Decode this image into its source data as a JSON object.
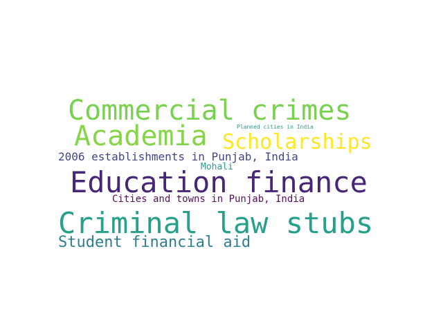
{
  "word_cloud": {
    "words": [
      {
        "text": "Commercial crimes",
        "color": "#7ad151"
      },
      {
        "text": "Academia",
        "color": "#86d549"
      },
      {
        "text": "Scholarships",
        "color": "#fde725"
      },
      {
        "text": "Planned cities in India",
        "color": "#2a9a8a"
      },
      {
        "text": "2006 establishments in Punjab, India",
        "color": "#414487"
      },
      {
        "text": "Mohali",
        "color": "#2a9d8f"
      },
      {
        "text": "Education finance",
        "color": "#482677"
      },
      {
        "text": "Cities and towns in Punjab, India",
        "color": "#570f5c"
      },
      {
        "text": "Criminal law stubs",
        "color": "#26a08a"
      },
      {
        "text": "Student financial aid",
        "color": "#2e7e8e"
      }
    ]
  }
}
